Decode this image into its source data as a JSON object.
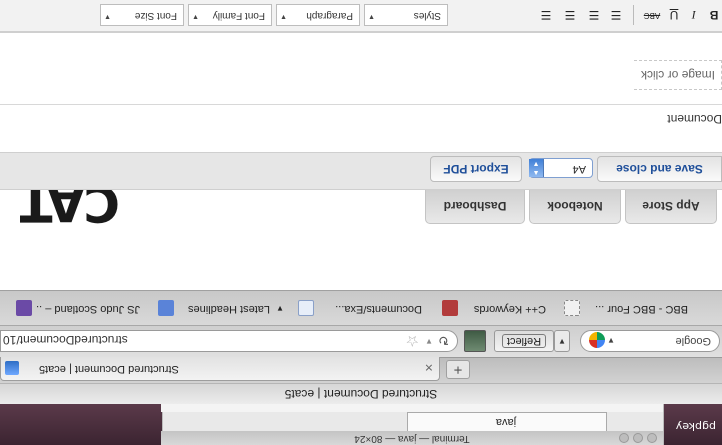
{
  "desktop": {
    "label": "pgpkey"
  },
  "terminal": {
    "title": "Terminal — java — 80×24",
    "tab_label": "java"
  },
  "window": {
    "title": "Structured Document | ecat5"
  },
  "tabs": [
    {
      "title": "Structured Document | ecat5"
    }
  ],
  "navbar": {
    "url": "structuredDocument/10",
    "search_placeholder": "Google",
    "reflect_label": "Reflect"
  },
  "bookmarks": [
    {
      "label": "JS Judo Scotland – ...",
      "icon": "js-icon"
    },
    {
      "label": "Latest Headlines",
      "icon": "rss-icon",
      "has_menu": true
    },
    {
      "label": "Documents/Exa...",
      "icon": "doc-icon"
    },
    {
      "label": "C++ Keywords",
      "icon": "cpp-icon"
    },
    {
      "label": "BBC - BBC Four ...",
      "icon": "bbc-icon"
    }
  ],
  "app": {
    "logo": "CAT",
    "nav": [
      "Dashboard",
      "Notebook",
      "App Store"
    ]
  },
  "toolbar": {
    "save_close": "Save and close",
    "page_size": "A4",
    "export_pdf": "Export PDF"
  },
  "document": {
    "label": "Document",
    "image_drop": "Image or click"
  },
  "editor": {
    "styles": "Styles",
    "format": "Paragraph",
    "font_family": "Font Family",
    "font_size": "Font Size",
    "buttons": [
      "B",
      "I",
      "U",
      "ABC"
    ]
  },
  "colors": {
    "link_blue": "#1f4f9a",
    "desktop_purple": "#4a2e3b"
  }
}
